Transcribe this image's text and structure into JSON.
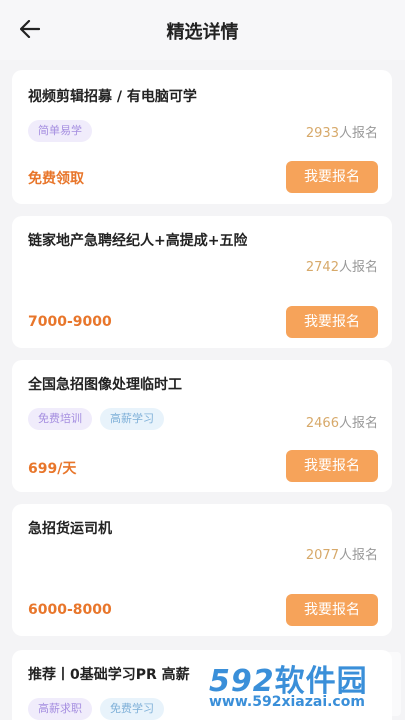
{
  "header": {
    "title": "精选详情"
  },
  "jobs": [
    {
      "title": "视频剪辑招募 / 有电脑可学",
      "tags": [
        "简单易学"
      ],
      "count": "2933",
      "count_suffix": "人报名",
      "salary": "免费领取",
      "apply_label": "我要报名"
    },
    {
      "title": "链家地产急聘经纪人+高提成+五险",
      "tags": [],
      "count": "2742",
      "count_suffix": "人报名",
      "salary": "7000-9000",
      "apply_label": "我要报名"
    },
    {
      "title": "全国急招图像处理临时工",
      "tags": [
        "免费培训",
        "高薪学习"
      ],
      "count": "2466",
      "count_suffix": "人报名",
      "salary": "699/天",
      "apply_label": "我要报名"
    },
    {
      "title": "急招货运司机",
      "tags": [],
      "count": "2077",
      "count_suffix": "人报名",
      "salary": "6000-8000",
      "apply_label": "我要报名"
    },
    {
      "title": "推荐丨0基础学习PR 高薪",
      "tags": [
        "高薪求职",
        "免费学习"
      ],
      "count": "",
      "count_suffix": "",
      "salary": "",
      "apply_label": ""
    }
  ],
  "watermark": {
    "digits": "592",
    "text": "软件园",
    "url": "www.592xiazai.com"
  },
  "colors": {
    "accent": "#f6a35a",
    "salary": "#e8762b",
    "count_number": "#d7a96a",
    "tag_purple": "#a58ee0",
    "tag_blue": "#7fb0d8",
    "watermark": "#3a8fd9"
  },
  "icons": {
    "back": "arrow-left-icon"
  }
}
